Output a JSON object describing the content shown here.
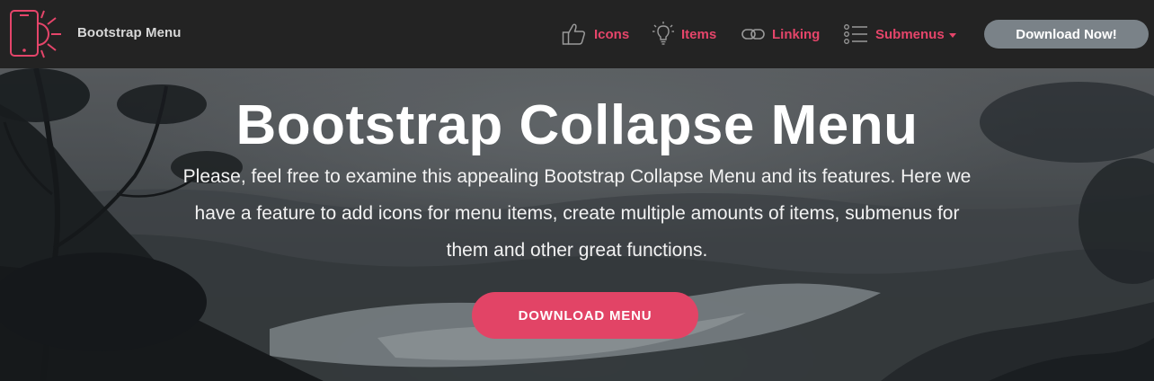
{
  "navbar": {
    "brand": {
      "name": "Bootstrap Menu",
      "logo_icon": "phone-sun-icon"
    },
    "items": [
      {
        "label": "Icons",
        "icon": "thumbs-up-icon"
      },
      {
        "label": "Items",
        "icon": "lightbulb-icon"
      },
      {
        "label": "Linking",
        "icon": "link-icon"
      },
      {
        "label": "Submenus",
        "icon": "list-icon",
        "has_dropdown": true
      }
    ],
    "download_label": "Download Now!"
  },
  "hero": {
    "title": "Bootstrap Collapse Menu",
    "description": "Please, feel free to examine this appealing Bootstrap Collapse Menu and its features. Here we have a feature to add icons for menu items, create multiple amounts of items, submenus for them and other great functions.",
    "button_label": "DOWNLOAD MENU"
  },
  "colors": {
    "navbar_bg": "#232323",
    "accent": "#e5456a",
    "nav_button_bg": "#7a8288",
    "hero_button_bg": "#e24466"
  }
}
